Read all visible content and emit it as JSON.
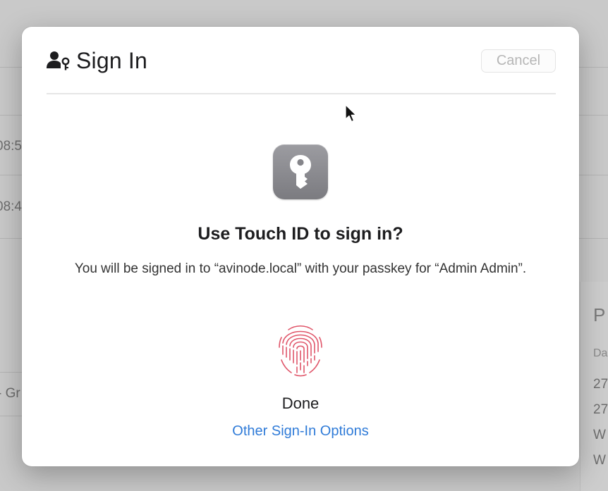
{
  "background": {
    "left_texts": [
      "08:5",
      "08:4",
      "- Gr"
    ],
    "right_panel": {
      "title": "P",
      "label": "Da",
      "rows": [
        "27",
        "27",
        "W",
        "W"
      ]
    }
  },
  "dialog": {
    "title": "Sign In",
    "title_icon": "person-key-icon",
    "cancel_label": "Cancel",
    "app_icon": "key-icon",
    "heading": "Use Touch ID to sign in?",
    "body": "You will be signed in to “avinode.local” with your passkey for “Admin Admin”.",
    "fingerprint_icon": "fingerprint-icon",
    "status": "Done",
    "other_options_label": "Other Sign-In Options"
  },
  "colors": {
    "link": "#2f7bd8",
    "fingerprint": "#e0566a",
    "app_icon_gray": "#8a8a8f"
  }
}
